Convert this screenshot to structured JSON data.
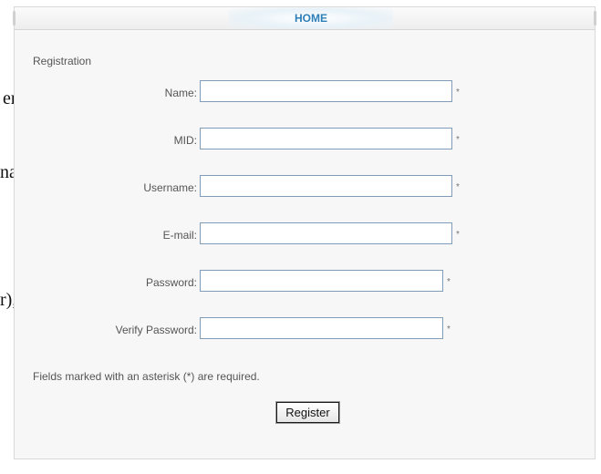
{
  "background_fragments": [
    "er",
    "nat",
    "r),"
  ],
  "nav": {
    "home_label": "HOME"
  },
  "form": {
    "section_title": "Registration",
    "fields": [
      {
        "label": "Name:",
        "value": "",
        "required_mark": "*"
      },
      {
        "label": "MID:",
        "value": "",
        "required_mark": "*"
      },
      {
        "label": "Username:",
        "value": "",
        "required_mark": "*"
      },
      {
        "label": "E-mail:",
        "value": "",
        "required_mark": "*"
      },
      {
        "label": "Password:",
        "value": "",
        "required_mark": "*"
      },
      {
        "label": "Verify Password:",
        "value": "",
        "required_mark": "*"
      }
    ],
    "required_note": "Fields marked with an asterisk (*) are required.",
    "submit_label": "Register"
  },
  "colors": {
    "accent": "#2d7fb8",
    "panel_bg": "#f7f7f7",
    "input_border": "#7f9db9",
    "label_text": "#555555"
  }
}
